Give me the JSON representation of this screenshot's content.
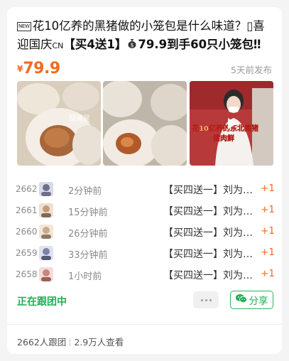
{
  "title": {
    "part1": "花10亿养的黑猪做的小笼包是什么味道？",
    "box_glyph": "▯",
    "part2": "喜迎国庆",
    "cn": "CN",
    "part3": "【买4送1】",
    "part4": "79.9到手60只小笼包‼",
    "ellipsis": " ...",
    "new_badge": "NEW"
  },
  "price": {
    "currency": "¥",
    "value": "79.9"
  },
  "published": "5天前发布",
  "images": [
    {
      "icon": "steamed-bun-photo",
      "overlay_text": "超满足"
    },
    {
      "icon": "steamed-bun-closeup-photo"
    },
    {
      "icon": "video-thumbnail",
      "overlay_text_1": "花10亿养的东北黑猪",
      "overlay_text_2": "猪肉鲜"
    }
  ],
  "orders": [
    {
      "index": "2662",
      "ago": "2分钟前",
      "item": "【买四送一】刘为…",
      "qty": "+1",
      "avatar_color": "#6d6f8a"
    },
    {
      "index": "2661",
      "ago": "15分钟前",
      "item": "【买四送一】刘为…",
      "qty": "+1",
      "avatar_color": "#c59a77"
    },
    {
      "index": "2660",
      "ago": "26分钟前",
      "item": "【买四送一】刘为…",
      "qty": "+1",
      "avatar_color": "#c8ab8d"
    },
    {
      "index": "2659",
      "ago": "33分钟前",
      "item": "【买四送一】刘为…",
      "qty": "+1",
      "avatar_color": "#7d82a6"
    },
    {
      "index": "2658",
      "ago": "1小时前",
      "item": "【买四送一】刘为…",
      "qty": "+1",
      "avatar_color": "#c9867f"
    }
  ],
  "status": "正在跟团中",
  "share_label": "分享",
  "footer": {
    "joined": "2662人跟团",
    "views": "2.9万人查看"
  },
  "colors": {
    "accent": "#f36b1c",
    "green": "#1fae53"
  }
}
